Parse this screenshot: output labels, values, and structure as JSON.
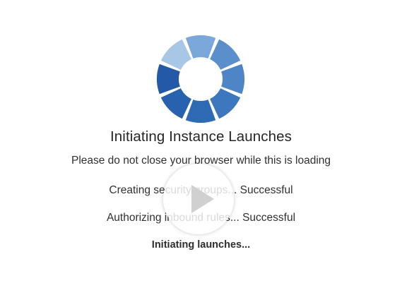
{
  "loading": {
    "title": "Initiating Instance Launches",
    "subtitle": "Please do not close your browser while this is loading",
    "steps": [
      {
        "text": "Creating security groups... Successful"
      },
      {
        "text": "Authorizing inbound rules... Successful"
      },
      {
        "text": "Initiating launches..."
      }
    ]
  },
  "icons": {
    "spinner": "loading-spinner-icon",
    "play": "play-icon"
  },
  "colors": {
    "spinner_dark": "#2463b0",
    "spinner_mid": "#4f87c7",
    "spinner_light": "#a9c7e6",
    "text": "#2b2b2b"
  }
}
